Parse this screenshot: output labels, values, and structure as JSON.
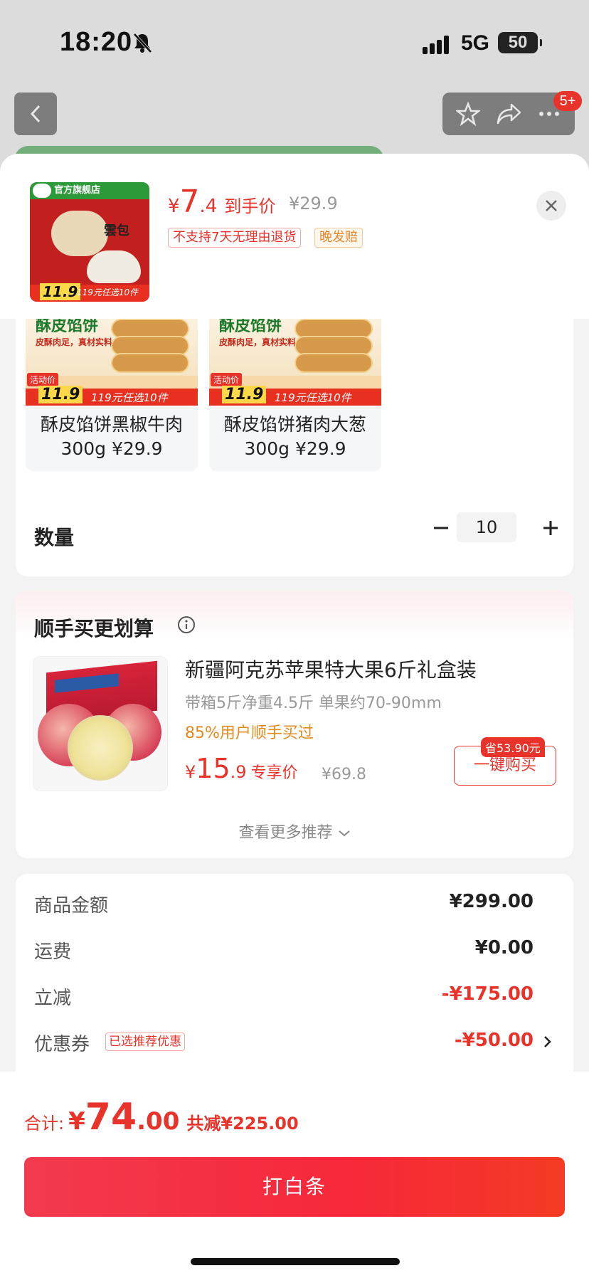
{
  "status_bar": {
    "time": "18:20",
    "network": "5G",
    "battery": "50"
  },
  "nav": {
    "badge": "5+"
  },
  "header": {
    "thumb_shop": "官方旗舰店",
    "thumb_title": "雲包",
    "thumb_price": "11.9",
    "thumb_offer": "119元任选10件",
    "price_currency": "¥",
    "price_int": "7",
    "price_dec": ".4",
    "price_label": "到手价",
    "original_price": "¥29.9",
    "tag_no_return": "不支持7天无理由退货",
    "tag_late_comp": "晚发赔"
  },
  "variants": [
    {
      "img_title": "酥皮馅饼",
      "img_sub": "皮酥肉足，真材实料",
      "price_badge": "11.9",
      "offer": "119元任选10件",
      "badge": "活动价",
      "name_line1": "酥皮馅饼黑椒牛肉",
      "name_line2": "300g ¥29.9"
    },
    {
      "img_title": "酥皮馅饼",
      "img_sub": "皮酥肉足，真材实料",
      "price_badge": "11.9",
      "offer": "119元任选10件",
      "badge": "活动价",
      "name_line1": "酥皮馅饼猪肉大葱",
      "name_line2": "300g ¥29.9"
    }
  ],
  "quantity": {
    "label": "数量",
    "value": "10"
  },
  "upsell": {
    "title": "顺手买更划算",
    "product_name": "新疆阿克苏苹果特大果6斤礼盒装",
    "spec": "带箱5斤净重4.5斤 单果约70-90mm",
    "buyers": "85%用户顺手买过",
    "price_currency": "¥",
    "price_int": "15",
    "price_dec": ".9",
    "price_label": "专享价",
    "original_price": "¥69.8",
    "save_badge": "省53.90元",
    "buy_button": "一键购买",
    "more": "查看更多推荐"
  },
  "breakdown": [
    {
      "label": "商品金额",
      "value": "¥299.00"
    },
    {
      "label": "运费",
      "value": "¥0.00"
    },
    {
      "label": "立减",
      "value": "-¥175.00"
    },
    {
      "label": "优惠券",
      "tag": "已选推荐优惠",
      "value": "-¥50.00"
    }
  ],
  "footer": {
    "total_label": "合计:",
    "total_currency": "¥",
    "total_int": "74",
    "total_dec": ".00",
    "total_saved": "共减¥225.00",
    "pay_button": "打白条"
  },
  "colors": {
    "accent": "#e8332b",
    "orange": "#e28a1e",
    "bg": "#f3f3f3"
  }
}
